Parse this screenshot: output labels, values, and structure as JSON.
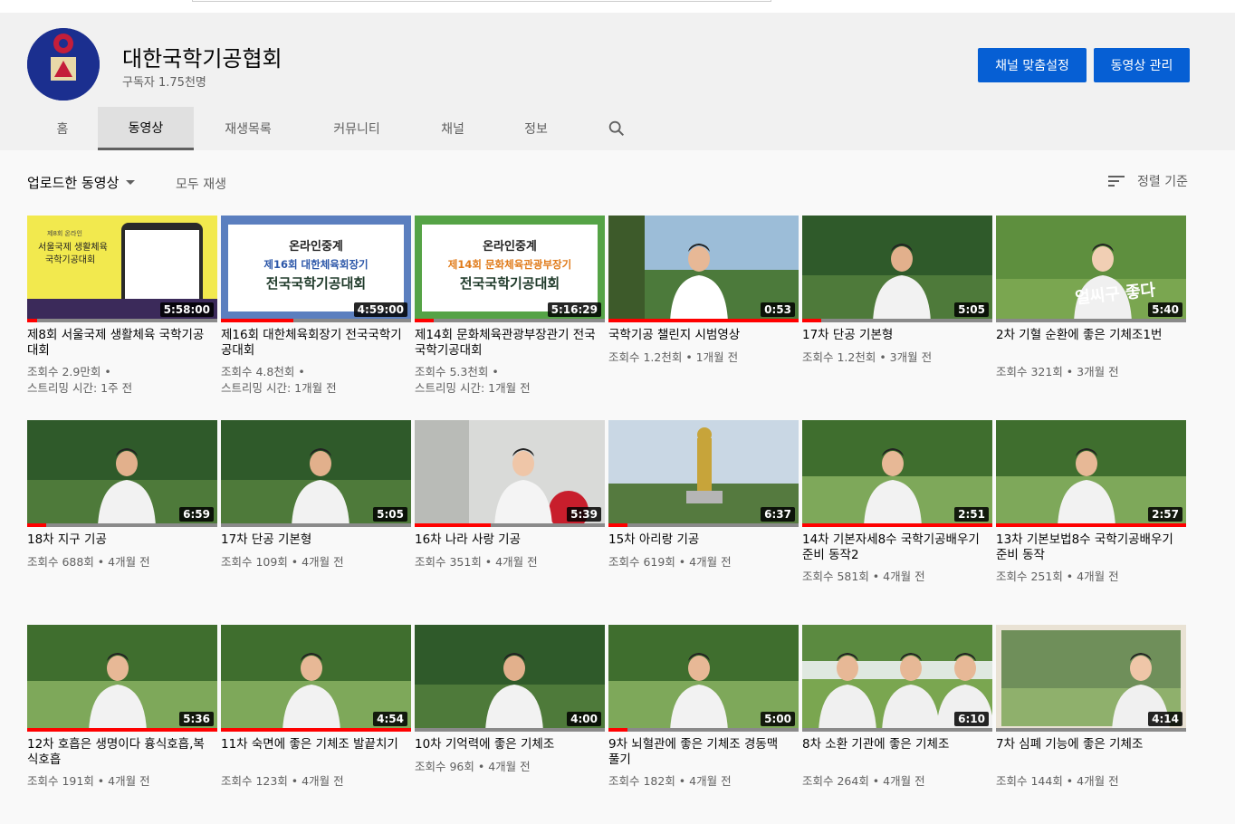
{
  "channel": {
    "name": "대한국학기공협회",
    "subscribers": "구독자 1.75천명",
    "customize_label": "채널 맞춤설정",
    "manage_label": "동영상 관리"
  },
  "tabs": [
    "홈",
    "동영상",
    "재생목록",
    "커뮤니티",
    "채널",
    "정보"
  ],
  "active_tab": "동영상",
  "toolbar": {
    "uploaded": "업로드한 동영상",
    "play_all": "모두 재생",
    "sort": "정렬 기준"
  },
  "videos": [
    {
      "title": "제8회 서울국제 생활체육 국학기공대회",
      "meta1": "조회수 2.9만회 •",
      "meta2": "스트리밍 시간: 1주 전",
      "duration": "5:58:00",
      "progress": 0.05,
      "thumb": "poster-yellow",
      "thumb_text": [
        "제8회 온라인",
        "서울국제 생활체육",
        "국학기공대회"
      ]
    },
    {
      "title": "제16회 대한체육회장기 전국국학기공대회",
      "meta1": "조회수 4.8천회 •",
      "meta2": "스트리밍 시간: 1개월 전",
      "duration": "4:59:00",
      "progress": 0.38,
      "thumb": "poster-blue",
      "thumb_text": [
        "온라인중계",
        "제16회 대한체육회장기",
        "전국국학기공대회"
      ]
    },
    {
      "title": "제14회 문화체육관광부장관기 전국국학기공대회",
      "meta1": "조회수 5.3천회 •",
      "meta2": "스트리밍 시간: 1개월 전",
      "duration": "5:16:29",
      "progress": 0.1,
      "thumb": "poster-green",
      "thumb_text": [
        "온라인중계",
        "제14회 문화체육관광부장기",
        "전국국학기공대회"
      ]
    },
    {
      "title": "국학기공 챌린지 시범영상",
      "meta1": "조회수 1.2천회 • 1개월 전",
      "meta2": "",
      "duration": "0:53",
      "progress": 1.0,
      "thumb": "person-outdoor",
      "thumb_text": []
    },
    {
      "title": "17차 단공 기본형",
      "meta1": "조회수 1.2천회 • 3개월 전",
      "meta2": "",
      "duration": "5:05",
      "progress": 0.1,
      "thumb": "person-forest",
      "thumb_text": []
    },
    {
      "title": "2차 기혈 순환에 좋은 기체조1번",
      "meta1": "조회수 321회 • 3개월 전",
      "meta2": "",
      "duration": "5:40",
      "progress": 0.0,
      "thumb": "person-smile",
      "thumb_text": [
        "얼씨구 좋다"
      ]
    },
    {
      "title": "18차 지구 기공",
      "meta1": "조회수 688회 • 4개월 전",
      "meta2": "",
      "duration": "6:59",
      "progress": 0.1,
      "thumb": "person-forest",
      "thumb_text": []
    },
    {
      "title": "17차 단공 기본형",
      "meta1": "조회수 109회 • 4개월 전",
      "meta2": "",
      "duration": "5:05",
      "progress": 0.0,
      "thumb": "person-forest",
      "thumb_text": []
    },
    {
      "title": "16차 나라 사랑 기공",
      "meta1": "조회수 351회 • 4개월 전",
      "meta2": "",
      "duration": "5:39",
      "progress": 0.4,
      "thumb": "person-flag",
      "thumb_text": []
    },
    {
      "title": "15차 아리랑 기공",
      "meta1": "조회수 619회 • 4개월 전",
      "meta2": "",
      "duration": "6:37",
      "progress": 0.1,
      "thumb": "statue",
      "thumb_text": []
    },
    {
      "title": "14차 기본자세8수 국학기공배우기 준비 동작2",
      "meta1": "조회수 581회 • 4개월 전",
      "meta2": "",
      "duration": "2:51",
      "progress": 1.0,
      "thumb": "person-lawn",
      "thumb_text": []
    },
    {
      "title": "13차 기본보법8수 국학기공배우기 준비 동작",
      "meta1": "조회수 251회 • 4개월 전",
      "meta2": "",
      "duration": "2:57",
      "progress": 1.0,
      "thumb": "person-lawn",
      "thumb_text": []
    },
    {
      "title": "12차 호흡은 생명이다 흉식호흡,복식호흡",
      "meta1": "조회수 191회 • 4개월 전",
      "meta2": "",
      "duration": "5:36",
      "progress": 1.0,
      "thumb": "person-lawn",
      "thumb_text": []
    },
    {
      "title": "11차 숙면에 좋은 기체조 발끝치기",
      "meta1": "조회수 123회 • 4개월 전",
      "meta2": "",
      "duration": "4:54",
      "progress": 1.0,
      "thumb": "person-lawn",
      "thumb_text": []
    },
    {
      "title": "10차 기억력에 좋은 기체조",
      "meta1": "조회수 96회 • 4개월 전",
      "meta2": "",
      "duration": "4:00",
      "progress": 0.0,
      "thumb": "person-forest",
      "thumb_text": []
    },
    {
      "title": "9차 뇌혈관에 좋은 기체조 경동맥 풀기",
      "meta1": "조회수 182회 • 4개월 전",
      "meta2": "",
      "duration": "5:00",
      "progress": 0.1,
      "thumb": "person-lawn",
      "thumb_text": []
    },
    {
      "title": "8차 소환 기관에 좋은 기체조",
      "meta1": "조회수 264회 • 4개월 전",
      "meta2": "",
      "duration": "6:10",
      "progress": 0.0,
      "thumb": "group-lawn",
      "thumb_text": []
    },
    {
      "title": "7차 심폐 기능에 좋은 기체조",
      "meta1": "조회수 144회 • 4개월 전",
      "meta2": "",
      "duration": "4:14",
      "progress": 0.0,
      "thumb": "person-frame",
      "thumb_text": []
    }
  ],
  "colors": {
    "accent": "#065fd4",
    "progress": "#ff0000"
  }
}
